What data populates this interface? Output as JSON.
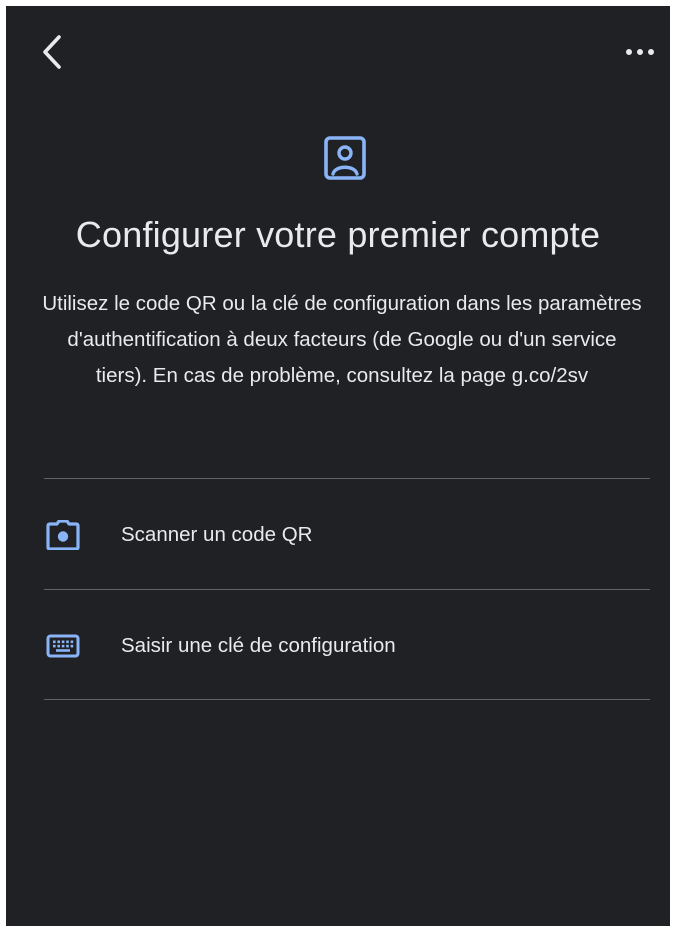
{
  "header": {
    "back_icon": "chevron-left-icon",
    "more_icon": "more-horiz-icon"
  },
  "main": {
    "icon": "account-box-icon",
    "title": "Configurer votre premier compte",
    "description": "Utilisez le code QR ou la clé de configuration dans les paramètres d'authentification à deux facteurs (de Google ou d'un service tiers). En cas de problème, consultez la page g.co/2sv"
  },
  "options": [
    {
      "label": "Scanner un code QR",
      "icon": "camera-icon"
    },
    {
      "label": "Saisir une clé de configuration",
      "icon": "keyboard-icon"
    }
  ],
  "colors": {
    "background": "#202124",
    "text": "#e8eaed",
    "accent": "#8ab4f8",
    "divider": "#5f6368"
  }
}
